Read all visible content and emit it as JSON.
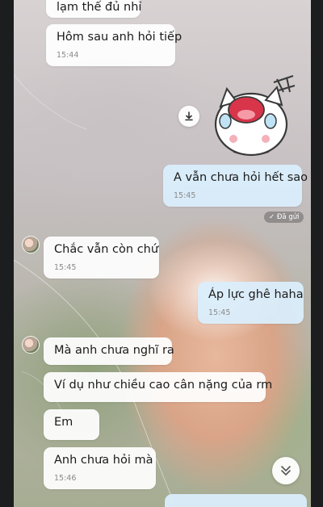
{
  "messages": [
    {
      "text": "lạm thế đủ nhỉ",
      "time": ""
    },
    {
      "text": "Hôm sau anh hỏi tiếp",
      "time": "15:44"
    },
    {
      "text": "A vẫn chưa hỏi hết sao",
      "time": "15:45"
    },
    {
      "text": "Chắc vẫn còn chứ",
      "time": "15:45"
    },
    {
      "text": "Áp lực ghê haha",
      "time": "15:45"
    },
    {
      "text": "Mà anh chưa nghĩ ra",
      "time": ""
    },
    {
      "text": "Ví dụ như chiều cao cân nặng của rm",
      "time": ""
    },
    {
      "text": "Em",
      "time": ""
    },
    {
      "text": "Anh chưa hỏi mà",
      "time": "15:46"
    }
  ],
  "status": {
    "sent_label": "Đã gửi"
  },
  "icons": {
    "download": "download-icon",
    "sticker": "crying-cat-sticker",
    "scroll_down": "double-chevron-down-icon",
    "check": "check-icon"
  },
  "colors": {
    "incoming_bubble": "#ffffff",
    "outgoing_bubble": "#daeefc",
    "time_text": "#8a8a8a"
  }
}
